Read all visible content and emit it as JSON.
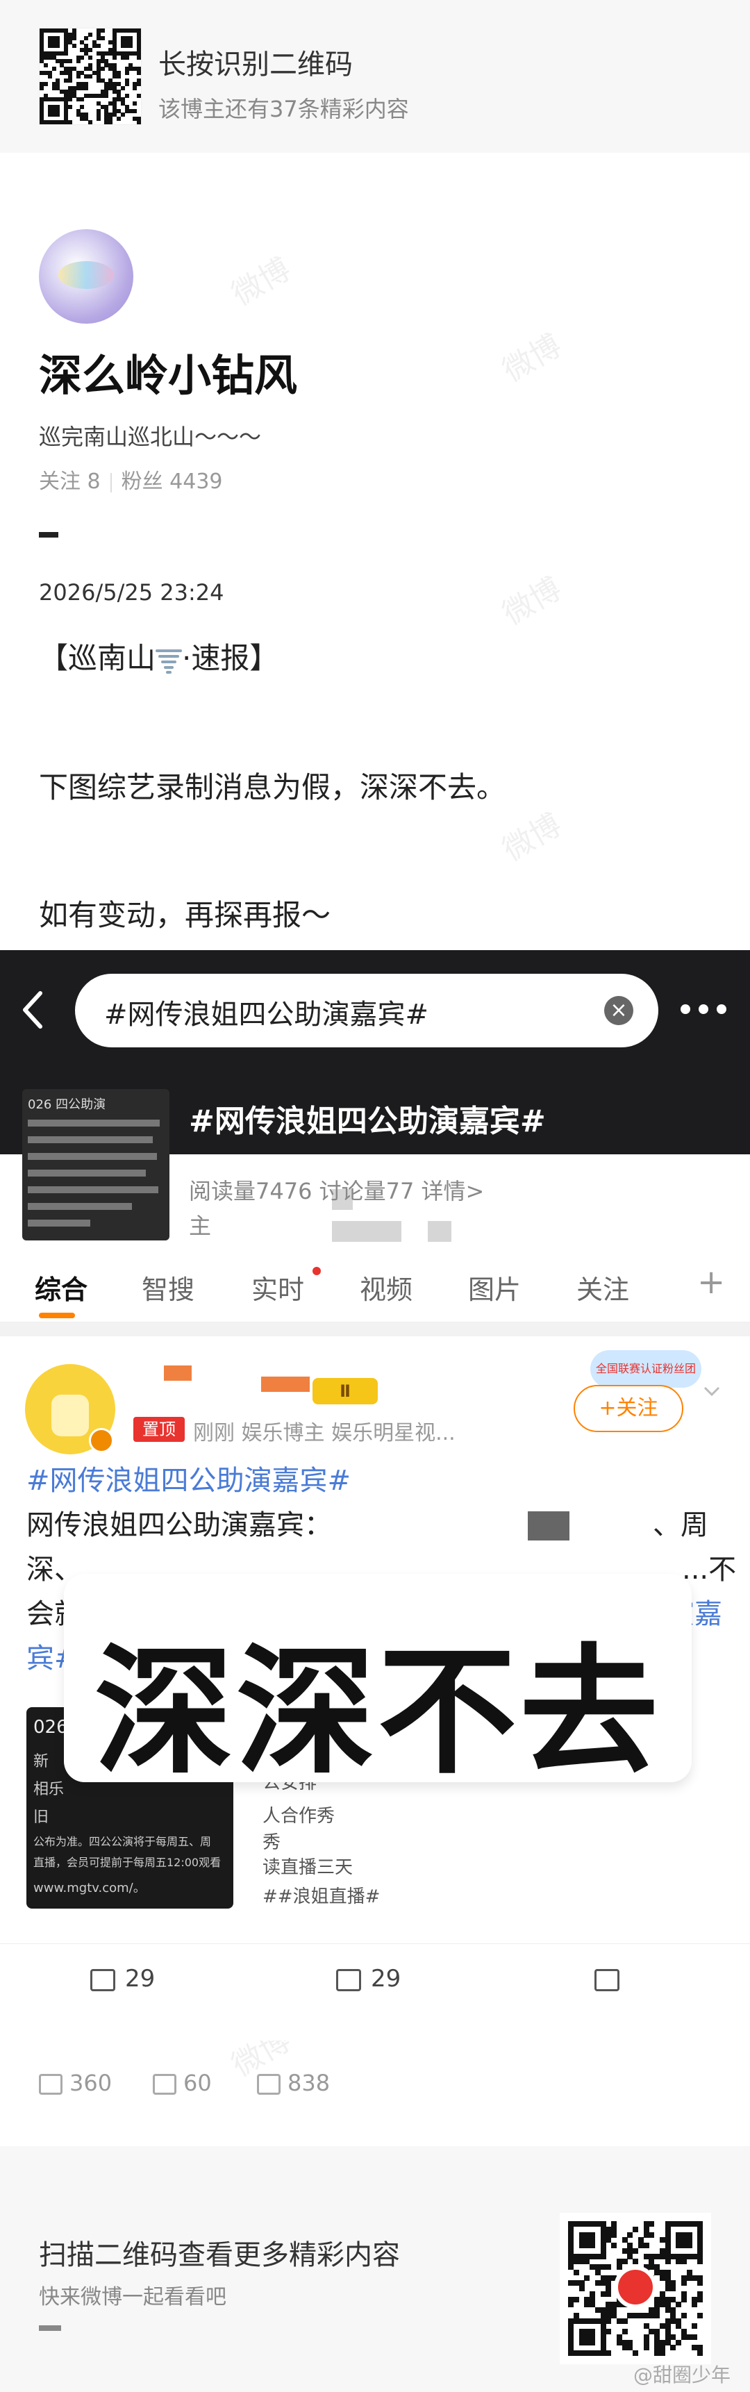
{
  "top_banner": {
    "title": "长按识别二维码",
    "subtitle": "该博主还有37条精彩内容"
  },
  "profile": {
    "name": "深么岭小钻风",
    "bio": "巡完南山巡北山～～～",
    "following": "关注 8",
    "followers": "粉丝 4439"
  },
  "post": {
    "time": "2026/5/25 23:24",
    "line1_pre": "【巡南山",
    "line1_post": "·速报】",
    "line2": "下图综艺录制消息为假，深深不去。",
    "line3": "如有变动，再探再报～",
    "reposts": "360",
    "comments": "60",
    "likes": "838"
  },
  "screenshot": {
    "search_text": "#网传浪姐四公助演嘉宾#",
    "thumb_title": "026 四公助演",
    "topic_title": "#网传浪姐四公助演嘉宾#",
    "topic_stats": "阅读量7476  讨论量77  详情>",
    "topic_host": "主",
    "tabs": [
      "综合",
      "智搜",
      "实时",
      "视频",
      "图片",
      "关注"
    ],
    "pin_badge": "置顶",
    "vip_label": "Ⅱ",
    "feed_meta": "刚刚  娱乐博主 娱乐明星视...",
    "follow_label": "+关注",
    "fan_sticker": "全国联赛认证粉丝团",
    "feed_topic": "#网传浪姐四公助演嘉宾#",
    "feed_line2_a": "网传浪姐四公助演嘉宾：",
    "feed_line2_b": "、周",
    "feed_line3_a": "深、",
    "feed_line3_b": "...不",
    "feed_line4_a": "会就",
    "feed_line4_b": "演嘉",
    "feed_line5": "宾#",
    "feed_thumb_title": "026 四",
    "feed_thumb_lines": [
      "新",
      "相乐",
      "旧",
      "公布为准。四公公演将于每周五、周",
      "直播，会员可提前于每周五12:00观看",
      "www.mgtv.com/。"
    ],
    "feed_side_lines": [
      "公安排",
      "人合作秀",
      "秀",
      "读直播三天",
      "##浪姐直播#"
    ],
    "stamp_text": "深深不去",
    "reposts": "29",
    "comments": "29"
  },
  "bottom_banner": {
    "title": "扫描二维码查看更多精彩内容",
    "subtitle": "快来微博一起看看吧"
  },
  "watermark_text": "@甜圈少年",
  "watermark_mark": "微博",
  "colors": {
    "accent": "#ff8200",
    "topic_blue": "#4a7bd6",
    "header_dark": "#1c1c1e"
  }
}
